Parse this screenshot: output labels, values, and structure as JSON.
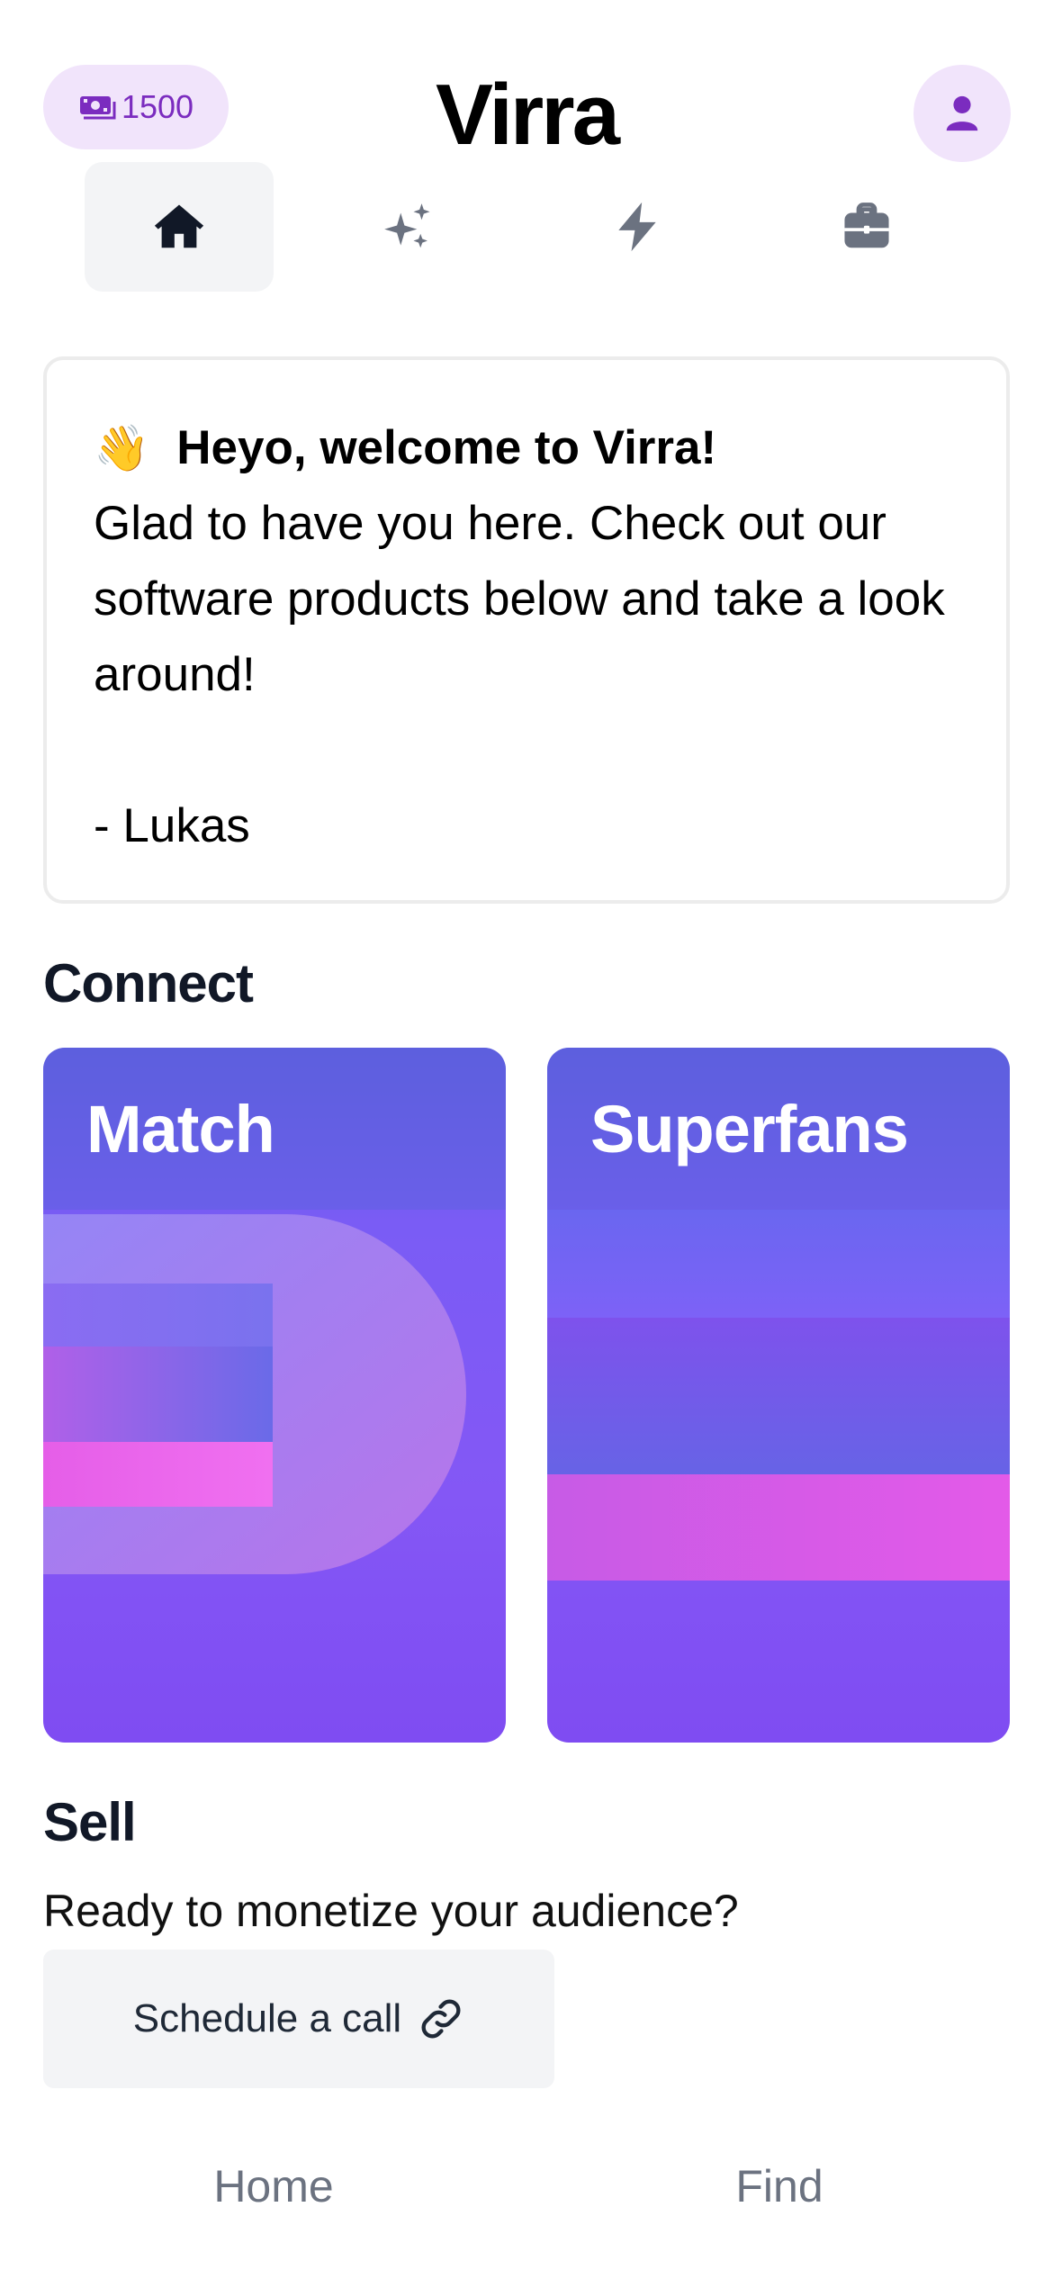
{
  "header": {
    "credits": "1500",
    "credits_icon": "money-icon",
    "title": "Virra",
    "profile_icon": "user-icon"
  },
  "top_nav": {
    "tabs": [
      {
        "icon": "home-icon",
        "active": true
      },
      {
        "icon": "sparkles-icon",
        "active": false
      },
      {
        "icon": "bolt-icon",
        "active": false
      },
      {
        "icon": "briefcase-icon",
        "active": false
      }
    ]
  },
  "welcome": {
    "emoji": "👋",
    "heading": "Heyo, welcome to Virra!",
    "body": "Glad to have you here. Check out our software products below and take a look around!",
    "signature": "- Lukas"
  },
  "connect": {
    "heading": "Connect",
    "cards": [
      {
        "title": "Match"
      },
      {
        "title": "Superfans"
      }
    ]
  },
  "sell": {
    "heading": "Sell",
    "subtitle": "Ready to monetize your audience?",
    "button_label": "Schedule a call",
    "button_icon": "link-icon"
  },
  "bottom_nav": {
    "items": [
      "Home",
      "Find"
    ]
  },
  "colors": {
    "accent": "#7b2cbf",
    "accent_bg": "#f1e4fb",
    "card_purple": "#8457f5",
    "card_pink": "#e055e8"
  }
}
